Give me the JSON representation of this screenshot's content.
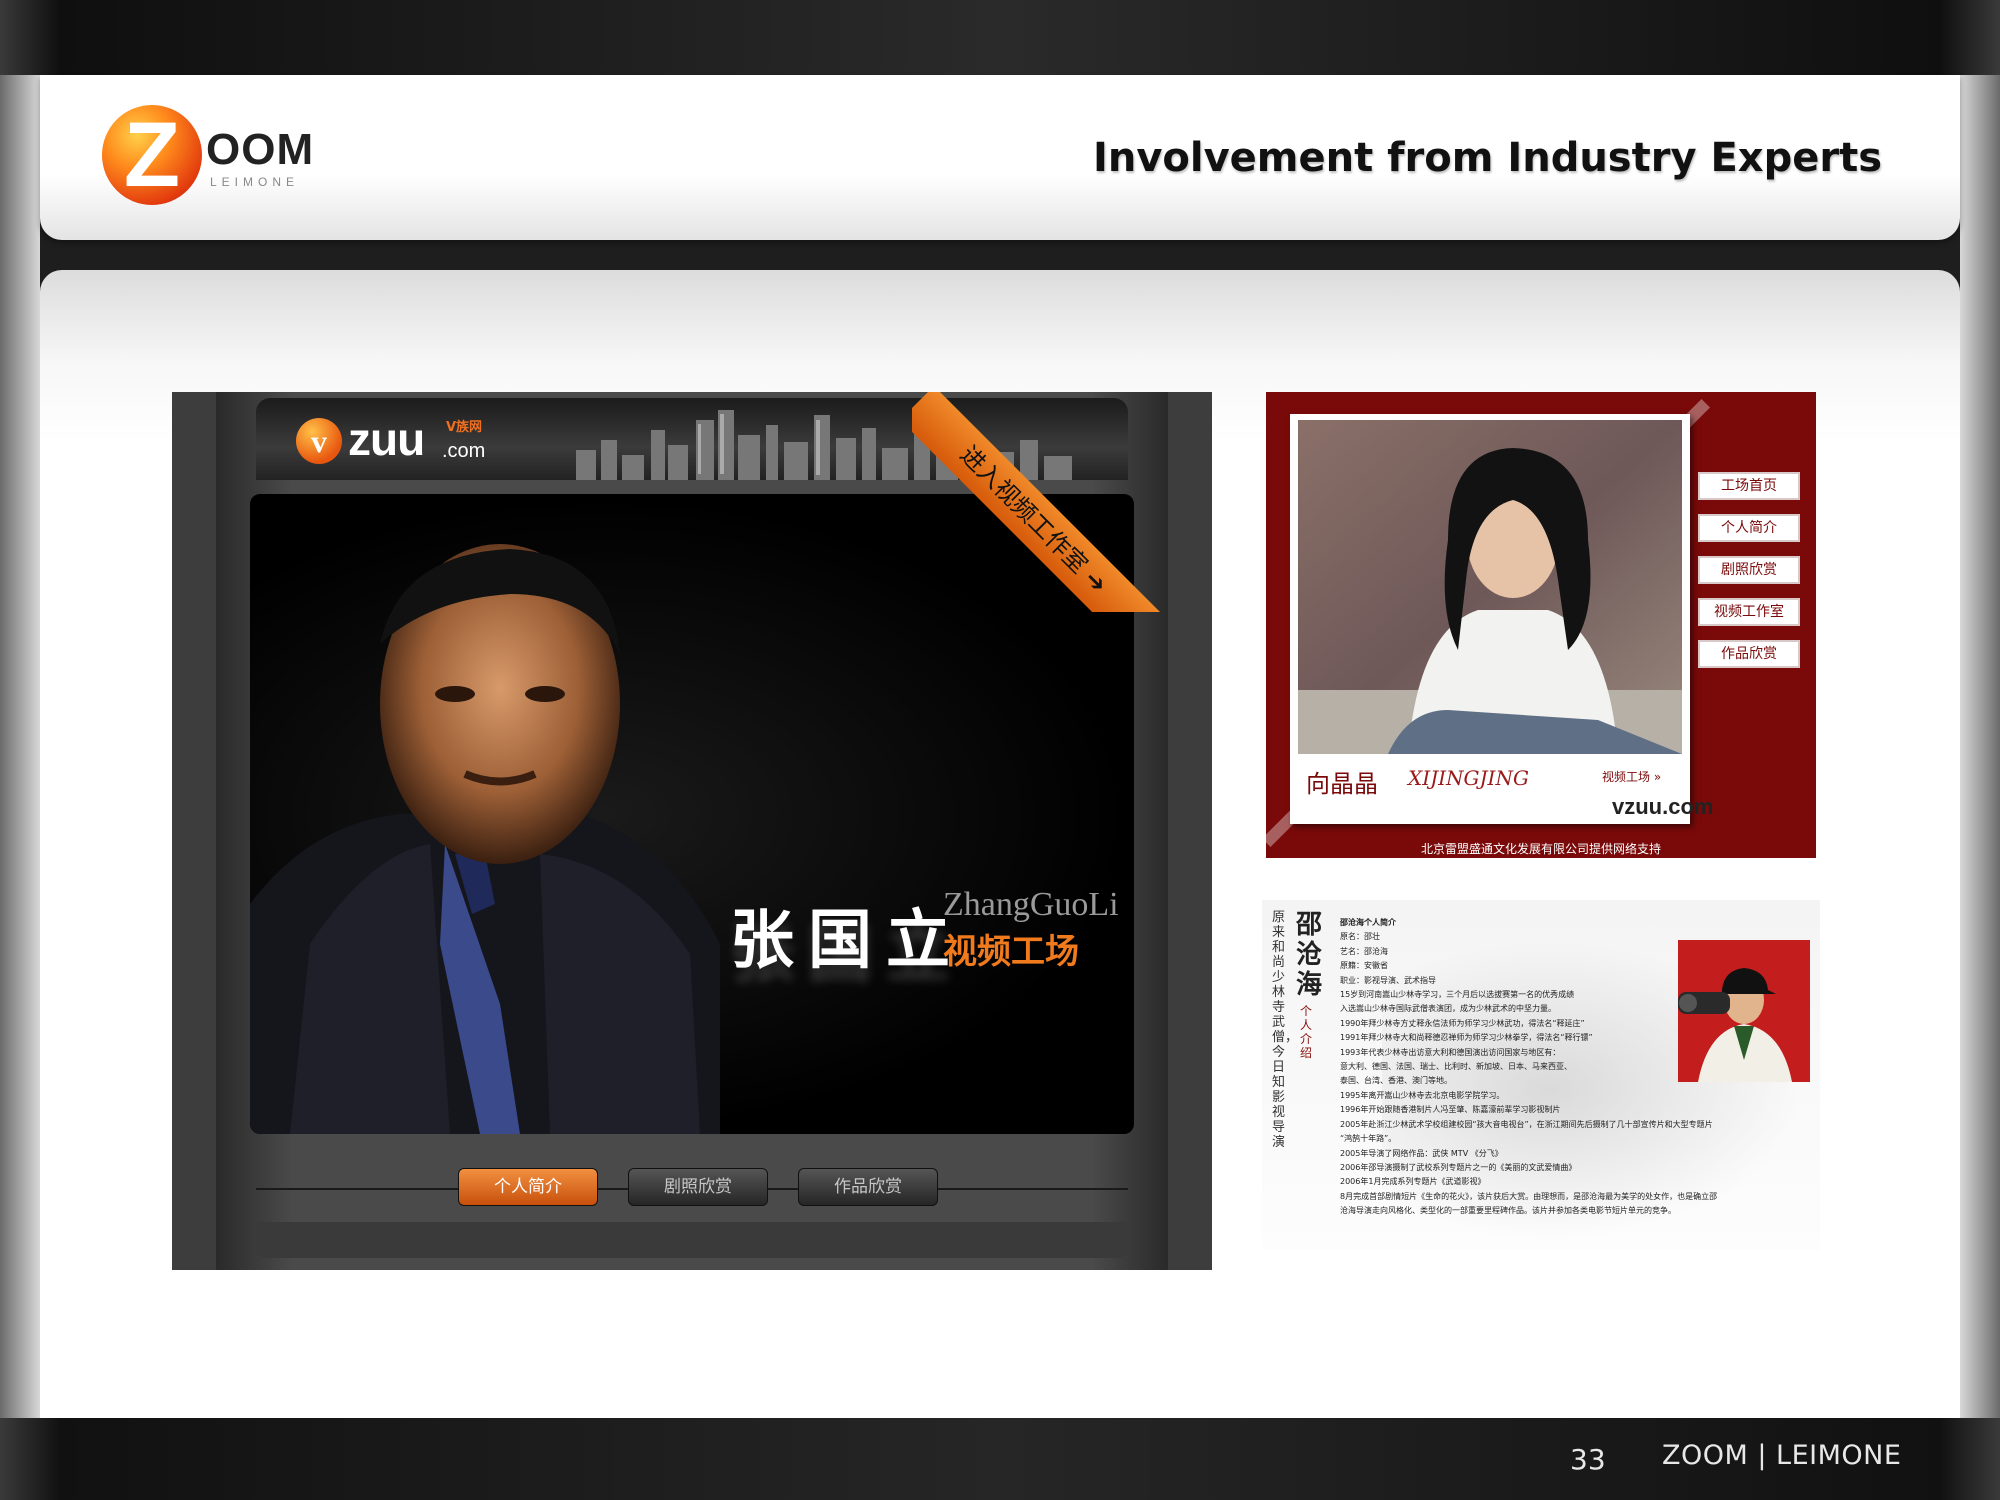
{
  "header": {
    "logo_letter": "Z",
    "logo_word": "OOM",
    "logo_sub": "LEIMONE",
    "title": "Involvement from Industry Experts"
  },
  "left_site": {
    "logo_v": "v",
    "logo_word": "zuu",
    "logo_com": ".com",
    "logo_cn": "V族网",
    "ribbon_text": "进入视频工作室 ➔",
    "name_cn": "张国立",
    "name_en": "ZhangGuoLi",
    "studio": "视频工场",
    "nav": [
      "个人简介",
      "剧照欣赏",
      "作品欣赏"
    ]
  },
  "right_top_site": {
    "name_cn": "向晶晶",
    "signature": "XIJINGJING",
    "studio_link": "视频工场 »",
    "logo": "vzuu.com",
    "nav": [
      "工场首页",
      "个人简介",
      "剧照欣赏",
      "视频工作室",
      "作品欣赏"
    ],
    "footer": "北京雷盟盛通文化发展有限公司提供网络支持"
  },
  "right_bottom_site": {
    "vertical_text": "原来和尚少林寺武僧，今日知影视导演",
    "name_cn": "邵沧海",
    "subtitle": "个人介绍",
    "bio_lines": [
      "邵沧海个人简介",
      "原名：邵壮",
      "艺名：邵沧海",
      "原籍：安徽省",
      "职业：影视导演、武术指导",
      "15岁到河南嵩山少林寺学习，三个月后以选拔赛第一名的优秀成绩",
      "入选嵩山少林寺国际武僧表演团，成为少林武术的中坚力量。",
      "1990年拜少林寺方丈释永信法师为师学习少林武功，得法名“释延庄”",
      "1991年拜少林寺大和尚释德忍禅师为师学习少林拳学，得法名“释行镖”",
      "1993年代表少林寺出访意大利和德国演出访问国家与地区有：",
      "意大利、德国、法国、瑞士、比利时、新加坡、日本、马来西亚、",
      "泰国、台湾、香港、澳门等地。",
      "1995年离开嵩山少林寺去北京电影学院学习。",
      "1996年开始跟随香港制片人冯至肇、陈嘉濠前辈学习影视制片",
      "2005年赴浙江少林武术学校组建校园“孩大音电视台”，在浙江期间先后摄制了几十部宣传片和大型专题片",
      "“鸿鹄十年路”。",
      "2005年导演了网络作品：武侠 MTV 《分飞》",
      "2006年邵导演摄制了武校系列专题片之一的《美丽的文武爱情曲》",
      "2006年1月完成系列专题片《武道影视》",
      "8月完成首部剧情短片《生命的花火》，该片获后大赏。由理想而，是邵沧海最为美学的处女作，也是确立邵",
      "沧海导演走向风格化、类型化的一部重要里程碑作品。该片并参加各类电影节短片单元的竞争。"
    ]
  },
  "footer": {
    "page_number": "33",
    "brand": "ZOOM | LEIMONE"
  }
}
